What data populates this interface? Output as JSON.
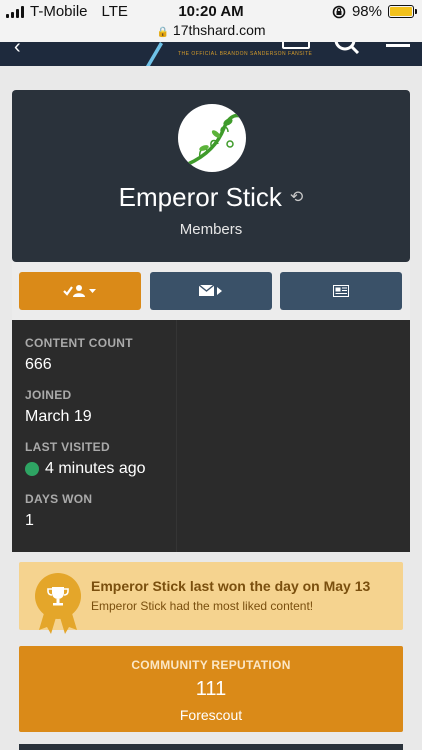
{
  "status_bar": {
    "carrier": "T-Mobile",
    "network": "LTE",
    "time": "10:20 AM",
    "battery": "98%",
    "battery_level": 0.98,
    "battery_color": "#f2c11b"
  },
  "browser": {
    "url": "17thshard.com"
  },
  "site_header": {
    "logo_text": "THE OFFICIAL BRANDON SANDERSON FANSITE"
  },
  "profile": {
    "name": "Emperor Stick",
    "group": "Members"
  },
  "actions": {
    "follow_icon": "check-user-caret-icon",
    "message_icon": "envelope-caret-icon",
    "content_icon": "newspaper-icon"
  },
  "stats": {
    "content_count_label": "CONTENT COUNT",
    "content_count": "666",
    "joined_label": "JOINED",
    "joined": "March 19",
    "last_visited_label": "LAST VISITED",
    "last_visited": "4 minutes ago",
    "days_won_label": "DAYS WON",
    "days_won": "1"
  },
  "won_day": {
    "title": "Emperor Stick last won the day on May 13",
    "subtitle": "Emperor Stick had the most liked content!"
  },
  "reputation": {
    "label": "COMMUNITY REPUTATION",
    "value": "111",
    "rank": "Forescout"
  },
  "colors": {
    "accent": "#da8a18",
    "header_navy": "#1e2a3d",
    "card_dark": "#2a323b",
    "online": "#2ea463"
  }
}
